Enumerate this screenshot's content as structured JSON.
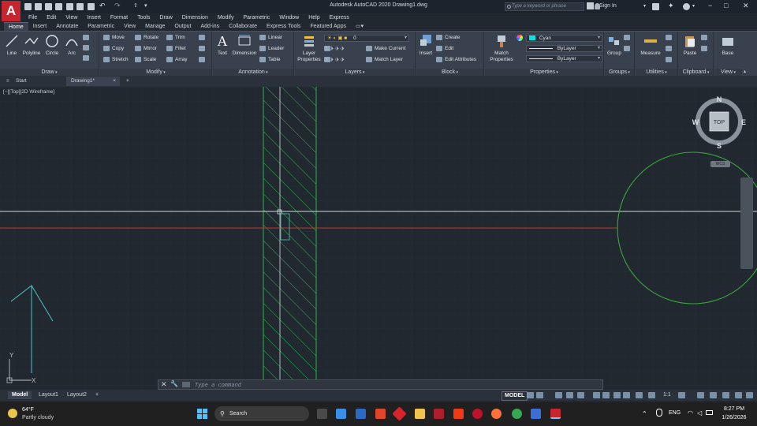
{
  "app": {
    "logo_letter": "A",
    "title": "Autodesk AutoCAD 2020    Drawing1.dwg",
    "search_placeholder": "Type a keyword or phrase",
    "sign_in": "Sign In"
  },
  "menu": [
    "File",
    "Edit",
    "View",
    "Insert",
    "Format",
    "Tools",
    "Draw",
    "Dimension",
    "Modify",
    "Parametric",
    "Window",
    "Help",
    "Express"
  ],
  "ribbon_tabs": [
    "Home",
    "Insert",
    "Annotate",
    "Parametric",
    "View",
    "Manage",
    "Output",
    "Add-ins",
    "Collaborate",
    "Express Tools",
    "Featured Apps"
  ],
  "ribbon": {
    "draw": {
      "title": "Draw",
      "line": "Line",
      "polyline": "Polyline",
      "circle": "Circle",
      "arc": "Arc"
    },
    "modify": {
      "title": "Modify",
      "move": "Move",
      "rotate": "Rotate",
      "trim": "Trim",
      "copy": "Copy",
      "mirror": "Mirror",
      "fillet": "Fillet",
      "stretch": "Stretch",
      "scale": "Scale",
      "array": "Array"
    },
    "annotation": {
      "title": "Annotation",
      "text": "Text",
      "dimension": "Dimension",
      "linear": "Linear",
      "leader": "Leader",
      "table": "Table"
    },
    "layers": {
      "title": "Layers",
      "layer_properties_1": "Layer",
      "layer_properties_2": "Properties",
      "layer_value": "0",
      "make_current": "Make Current",
      "match_layer": "Match Layer"
    },
    "block": {
      "title": "Block",
      "insert": "Insert",
      "create": "Create",
      "edit": "Edit",
      "edit_attributes": "Edit Attributes"
    },
    "properties": {
      "title": "Properties",
      "match_1": "Match",
      "match_2": "Properties",
      "color": "Cyan",
      "linetype": "ByLayer",
      "lineweight": "ByLayer"
    },
    "groups": {
      "title": "Groups",
      "group": "Group"
    },
    "utilities": {
      "title": "Utilities",
      "measure": "Measure"
    },
    "clipboard": {
      "title": "Clipboard",
      "paste": "Paste"
    },
    "view": {
      "title": "View",
      "base": "Base"
    }
  },
  "file_tabs": {
    "start": "Start",
    "drawing": "Drawing1*",
    "close": "×",
    "add": "+"
  },
  "viewport": {
    "label": "[−][Top][2D Wireframe]",
    "compass_n": "N",
    "compass_s": "S",
    "compass_e": "E",
    "compass_w": "W",
    "cube_face": "TOP",
    "wcs": "WCS",
    "ucs_x": "X",
    "ucs_y": "Y"
  },
  "command": {
    "placeholder": "Type a command"
  },
  "layout_tabs": [
    "Model",
    "Layout1",
    "Layout2"
  ],
  "status": {
    "model": "MODEL",
    "scale": "1:1"
  },
  "taskbar": {
    "temperature": "64°F",
    "weather": "Partly cloudy",
    "search": "Search",
    "lang": "ENG",
    "time": "8:27 PM",
    "date": "1/26/2026"
  },
  "colors": {
    "hatch": "#2db34a",
    "circle": "#3aa83a",
    "x_axis": "#c0392b",
    "horizontal_line": "#cfd8dc",
    "ucs": "#4fc3c0",
    "background": "#212830"
  }
}
